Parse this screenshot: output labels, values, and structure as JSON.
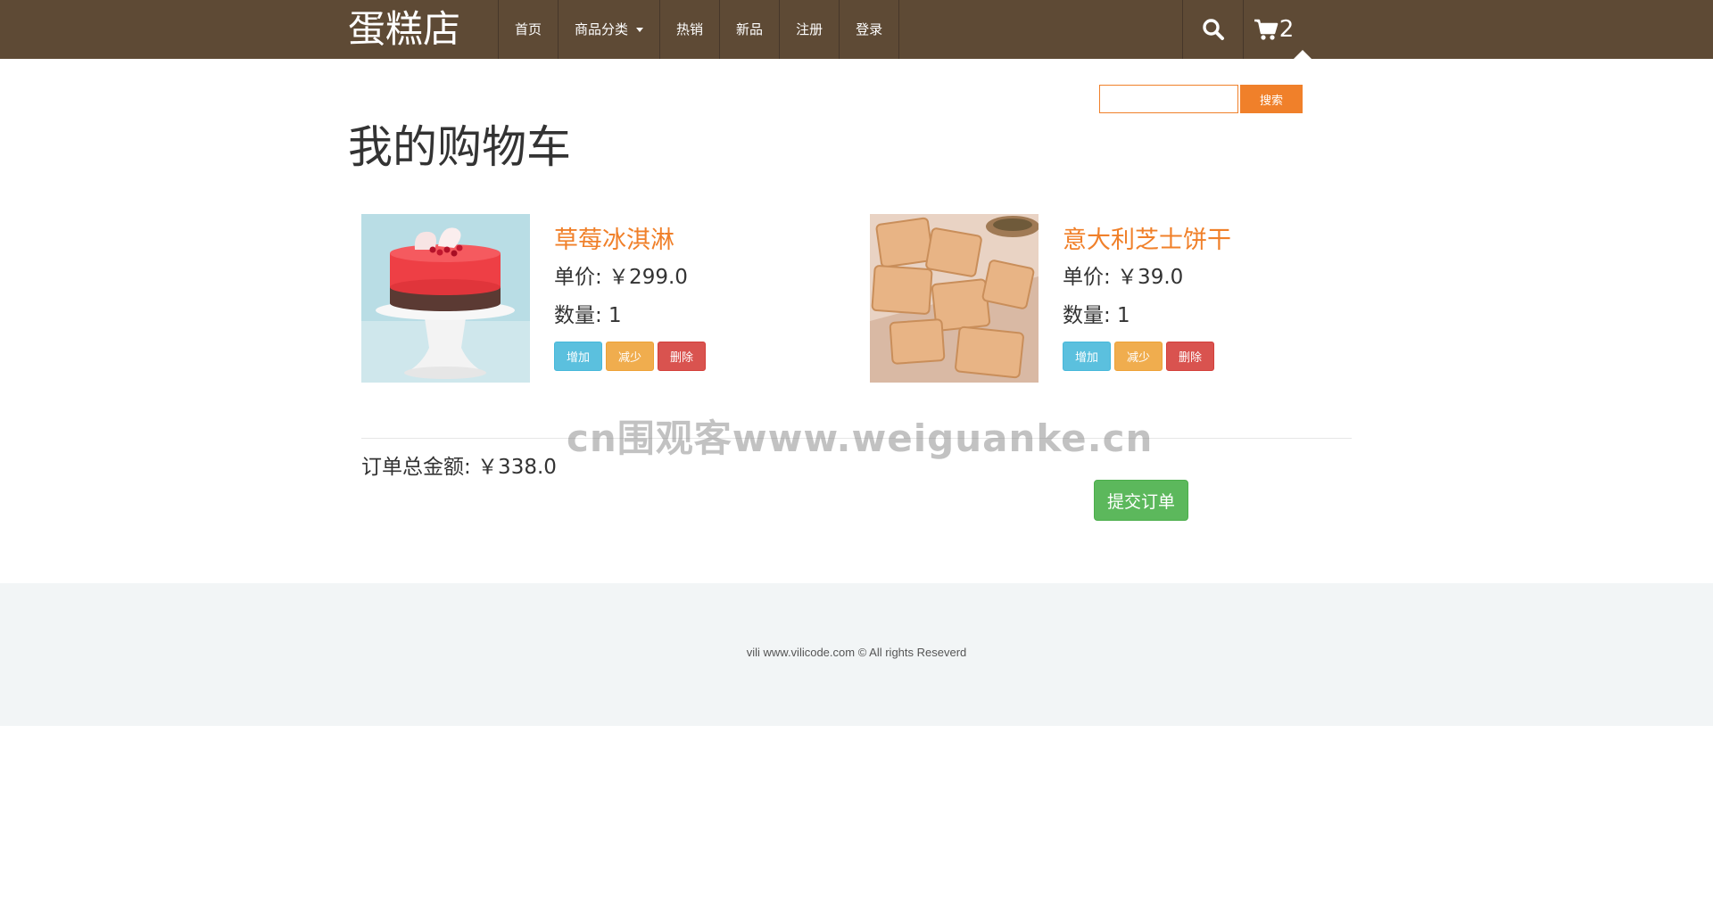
{
  "header": {
    "brand": "蛋糕店",
    "nav": [
      {
        "label": "首页"
      },
      {
        "label": "商品分类"
      },
      {
        "label": "热销"
      },
      {
        "label": "新品"
      },
      {
        "label": "注册"
      },
      {
        "label": "登录"
      }
    ],
    "search_icon": "search-icon",
    "cart_icon": "shopping-cart-icon",
    "cart_count": "2"
  },
  "search": {
    "value": "",
    "button_label": "搜索"
  },
  "page_title": "我的购物车",
  "cart": {
    "items": [
      {
        "name": "草莓冰淇淋",
        "price": "单价: ￥299.0",
        "quantity": "数量: 1",
        "image": "red-strawberry-cake-on-white-stand"
      },
      {
        "name": "意大利芝士饼干",
        "price": "单价: ￥39.0",
        "quantity": "数量: 1",
        "image": "cheese-biscuits-stack"
      }
    ],
    "buttons": {
      "increase": "增加",
      "decrease": "减少",
      "delete": "删除"
    },
    "total": "订单总金额: ￥338.0",
    "submit_label": "提交订单"
  },
  "watermark": "cn围观客www.weiguanke.cn",
  "footer": {
    "copyright": "vili www.vilicode.com © All rights Reseverd"
  },
  "colors": {
    "nav_bg": "#5e4a35",
    "accent": "#f0802a",
    "info": "#5bc0de",
    "warning": "#f0ad4e",
    "danger": "#d9534f",
    "success": "#5cb85c",
    "footer_bg": "#f2f5f6"
  }
}
